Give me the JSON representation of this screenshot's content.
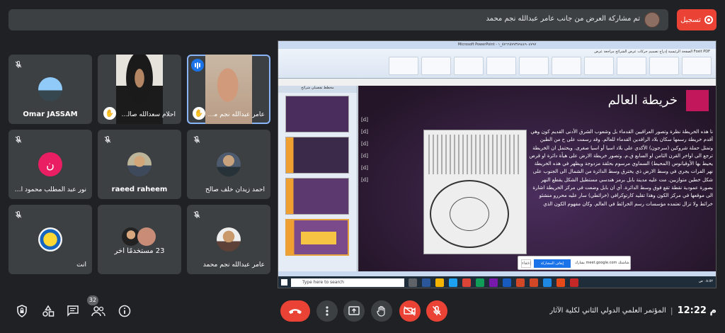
{
  "top_bar": {
    "notice": "تم مشاركة العرض من جانب عامر عبدالله نجم محمد",
    "record_label": "تسجيل"
  },
  "tiles": [
    {
      "name": "Omar JASSAM"
    },
    {
      "name": "احلام سعدالله صالح ..."
    },
    {
      "name": "عامر عبدالله نجم محمد"
    },
    {
      "name": "نور عبد المطلب محمود السـ...",
      "initial": "ن"
    },
    {
      "name": "raeed raheem"
    },
    {
      "name": "أحمد زيدان خلف صالح"
    },
    {
      "name": "أنت"
    },
    {
      "name": "23 مستخدمًا آخر"
    },
    {
      "name": "عامر عبدالله نجم محمد"
    }
  ],
  "screen_share": {
    "window_title": "Microsoft PowerPoint - ٥٧٦٦٥٧٧٣٨٩٤٤٩٠٤٧٩٧_١",
    "ribbon_tabs": "الصفحة الرئيسية   إدراج   تصميم   حركات   عرض الشرائح   مراجعة   عرض   Foxit PDF",
    "thumbs_header": "مخطط تفصيلي   شرائح",
    "slide_title": "خريطة العالم",
    "slide_text": "نا هذه الخريطة نظرة وتصور العراقيين القدماء بل وشعوب الشرق الأدنى القديم كون وهي أقدم خريطة رسمها سكان بلاد الرافدين القدماء للعالم. وقد رسمت على ح من الطين وتمثل حملة شروكين (سرجون) الأكدي على بلاد اسيا أو اسيا صغرى. ويحتمل ان الخريطة ترجع الى اواخر القرن الثامن او السابع ق.م. وتصور خريطة الارض على هيأة دائرة او قرص يحيط بها الأوقيانوس (المحيط) السماوي مرسوم بحلقة مزدوجة ويظهر في هذه الخريطة نهر الفرات يجري في وسط الارض ذي يخترق وسط الدائرة من الشمال الى الجنوب على شكل خطين متوازيين. مت عليه مدينة بابل برمز هندسي مستطيل الشكل يقطع النهر بصورة عمودية نقطة تقع فوق وسط الدائرة. أي ان بابل وضعت في مركز الخريطة اشارة الى موقعها في مركز الكون وهذا تقليد كارتوكرافي (خرائطي) سار عليه محررو منشئو خرائط ولا تزال تعتمده مؤسسات رسم الخرائط في العالم. وكان مفهوم الكون الذي",
    "cuneiform_lines": [
      "[d]",
      "[d]",
      "[d]",
      "[d]",
      "[d]",
      "[d]"
    ],
    "notif_button": "إيقاف المشاركة",
    "notif_text": "يشارك meet.google.com شاشتك.",
    "notif_hide": "إخفاء",
    "taskbar_search": "Type here to search",
    "tray_time": "٠٨:٥٢ ص"
  },
  "bottom_bar": {
    "participants_count": "32",
    "time": "12:22 م",
    "separator": "|",
    "meeting_name": "المؤتمر العلمي الدولي الثاني لكلية الآثار"
  }
}
